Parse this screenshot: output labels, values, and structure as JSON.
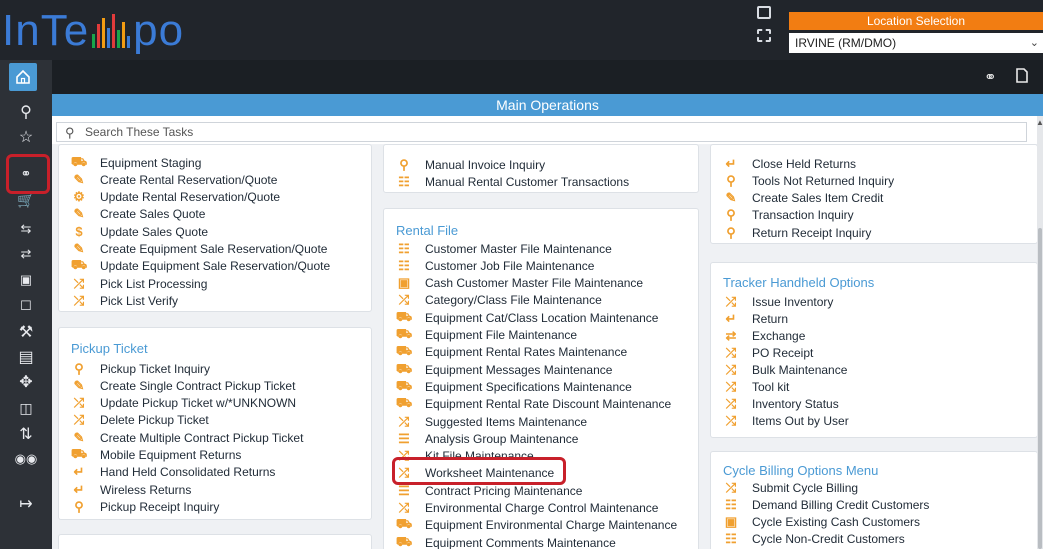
{
  "app": {
    "logo_text_left": "InTe",
    "logo_text_right": "po",
    "logo_bar_colors": [
      "#1aa64a",
      "#e23b3b",
      "#f39c12",
      "#3b7bd6",
      "#e23b3b",
      "#1aa64a",
      "#f39c12",
      "#3b7bd6"
    ]
  },
  "location": {
    "label": "Location Selection",
    "value": "IRVINE (RM/DMO)"
  },
  "colors": {
    "accent_blue": "#4a9ad4",
    "location_orange": "#f27d12",
    "icon_orange": "#f0a030",
    "highlight_red": "#c8202a"
  },
  "nav": {
    "icons": [
      "home-icon",
      "search-icon",
      "star-icon",
      "link-icon",
      "cart-icon",
      "exchange-left-icon",
      "exchange-right-icon",
      "calculator-icon",
      "document-search-icon",
      "wrench-icon",
      "lock-icon",
      "move-icon",
      "trash-icon",
      "repeat-icon",
      "coins-icon",
      "logout-icon"
    ]
  },
  "main": {
    "section_title": "Main Operations",
    "search_placeholder": "Search These Tasks"
  },
  "cards": {
    "col1_top": {
      "items": [
        {
          "label": "Equipment Staging",
          "icon": "truck-icon"
        },
        {
          "label": "Create Rental Reservation/Quote",
          "icon": "pencil-icon"
        },
        {
          "label": "Update Rental Reservation/Quote",
          "icon": "gear-icon"
        },
        {
          "label": "Create Sales Quote",
          "icon": "pencil-icon"
        },
        {
          "label": "Update Sales Quote",
          "icon": "dollar-icon"
        },
        {
          "label": "Create Equipment Sale Reservation/Quote",
          "icon": "pencil-icon"
        },
        {
          "label": "Update Equipment Sale Reservation/Quote",
          "icon": "truck-icon"
        },
        {
          "label": "Pick List Processing",
          "icon": "shuffle-icon"
        },
        {
          "label": "Pick List Verify",
          "icon": "shuffle-icon"
        }
      ]
    },
    "pickup": {
      "title": "Pickup Ticket",
      "items": [
        {
          "label": "Pickup Ticket Inquiry",
          "icon": "search-icon"
        },
        {
          "label": "Create Single Contract Pickup Ticket",
          "icon": "pencil-icon"
        },
        {
          "label": "Update Pickup Ticket w/*UNKNOWN",
          "icon": "shuffle-icon"
        },
        {
          "label": "Delete Pickup Ticket",
          "icon": "shuffle-icon"
        },
        {
          "label": "Create Multiple Contract Pickup Ticket",
          "icon": "pencil-icon"
        },
        {
          "label": "Mobile Equipment Returns",
          "icon": "truck-icon"
        },
        {
          "label": "Hand Held Consolidated Returns",
          "icon": "return-icon"
        },
        {
          "label": "Wireless Returns",
          "icon": "return-icon"
        },
        {
          "label": "Pickup Receipt Inquiry",
          "icon": "search-icon"
        }
      ]
    },
    "col2_top": {
      "items": [
        {
          "label": "Manual Invoice Inquiry",
          "icon": "search-icon"
        },
        {
          "label": "Manual Rental Customer Transactions",
          "icon": "people-icon"
        }
      ]
    },
    "rental_file": {
      "title": "Rental File",
      "items": [
        {
          "label": "Customer Master File Maintenance",
          "icon": "people-icon"
        },
        {
          "label": "Customer Job File Maintenance",
          "icon": "people-icon"
        },
        {
          "label": "Cash Customer Master File Maintenance",
          "icon": "cash-icon"
        },
        {
          "label": "Category/Class File Maintenance",
          "icon": "shuffle-icon"
        },
        {
          "label": "Equipment Cat/Class Location Maintenance",
          "icon": "truck-icon"
        },
        {
          "label": "Equipment File Maintenance",
          "icon": "truck-icon"
        },
        {
          "label": "Equipment Rental Rates Maintenance",
          "icon": "truck-icon"
        },
        {
          "label": "Equipment Messages Maintenance",
          "icon": "truck-icon"
        },
        {
          "label": "Equipment Specifications Maintenance",
          "icon": "truck-icon"
        },
        {
          "label": "Equipment Rental Rate Discount Maintenance",
          "icon": "truck-icon"
        },
        {
          "label": "Suggested Items Maintenance",
          "icon": "shuffle-icon"
        },
        {
          "label": "Analysis Group Maintenance",
          "icon": "list-icon"
        },
        {
          "label": "Kit File Maintenance",
          "icon": "shuffle-icon"
        },
        {
          "label": "Worksheet Maintenance",
          "icon": "shuffle-icon"
        },
        {
          "label": "Contract Pricing Maintenance",
          "icon": "list-icon"
        },
        {
          "label": "Environmental Charge Control Maintenance",
          "icon": "shuffle-icon"
        },
        {
          "label": "Equipment Environmental Charge Maintenance",
          "icon": "truck-icon"
        },
        {
          "label": "Equipment Comments Maintenance",
          "icon": "truck-icon"
        }
      ]
    },
    "col3_top": {
      "items": [
        {
          "label": "Close Held Returns",
          "icon": "return-icon"
        },
        {
          "label": "Tools Not Returned Inquiry",
          "icon": "search-icon"
        },
        {
          "label": "Create Sales Item Credit",
          "icon": "pencil-icon"
        },
        {
          "label": "Transaction Inquiry",
          "icon": "search-icon"
        },
        {
          "label": "Return Receipt Inquiry",
          "icon": "search-icon"
        }
      ]
    },
    "tracker": {
      "title": "Tracker Handheld Options",
      "items": [
        {
          "label": "Issue Inventory",
          "icon": "shuffle-icon"
        },
        {
          "label": "Return",
          "icon": "return-icon"
        },
        {
          "label": "Exchange",
          "icon": "exchange-icon"
        },
        {
          "label": "PO Receipt",
          "icon": "shuffle-icon"
        },
        {
          "label": "Bulk Maintenance",
          "icon": "shuffle-icon"
        },
        {
          "label": "Tool kit",
          "icon": "shuffle-icon"
        },
        {
          "label": "Inventory Status",
          "icon": "shuffle-icon"
        },
        {
          "label": "Items Out by User",
          "icon": "shuffle-icon"
        }
      ]
    },
    "cycle": {
      "title": "Cycle Billing Options Menu",
      "items": [
        {
          "label": "Submit Cycle Billing",
          "icon": "shuffle-icon"
        },
        {
          "label": "Demand Billing Credit Customers",
          "icon": "people-icon"
        },
        {
          "label": "Cycle Existing Cash Customers",
          "icon": "cash-icon"
        },
        {
          "label": "Cycle Non-Credit Customers",
          "icon": "people-icon"
        }
      ]
    }
  }
}
